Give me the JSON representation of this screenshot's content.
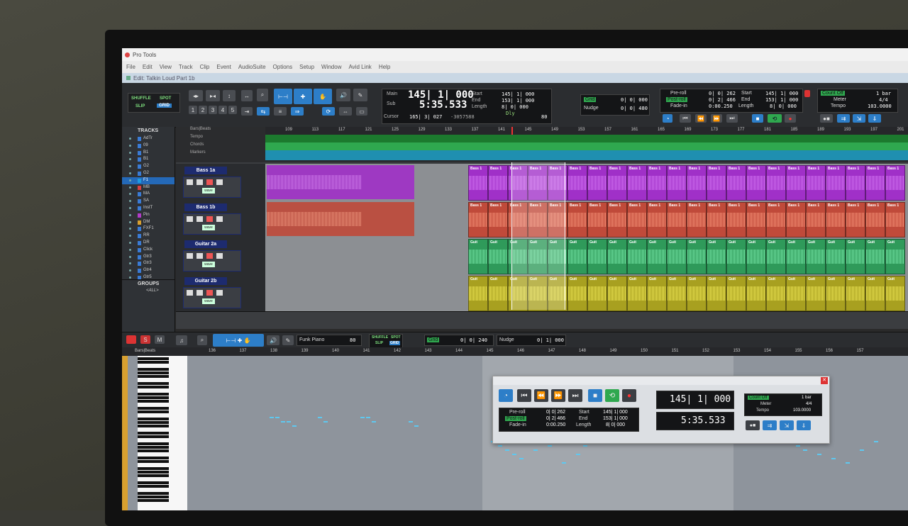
{
  "app": {
    "title": "Pro Tools",
    "edit_window_title": "Edit: Talkin Loud Part 1b"
  },
  "menu": [
    "File",
    "Edit",
    "View",
    "Track",
    "Clip",
    "Event",
    "AudioSuite",
    "Options",
    "Setup",
    "Window",
    "Avid Link",
    "Help"
  ],
  "modes": {
    "shuffle": "SHUFFLE",
    "spot": "SPOT",
    "slip": "SLIP",
    "grid": "GRID"
  },
  "grid_numbers": [
    "1",
    "2",
    "3",
    "4",
    "5"
  ],
  "counter": {
    "main_label": "Main",
    "main_value": "145| 1| 000",
    "sub_label": "Sub",
    "sub_value": "5:35.533",
    "start_label": "Start",
    "start_value": "145| 1| 000",
    "end_label": "End",
    "end_value": "153| 1| 000",
    "length_label": "Length",
    "length_value": "8| 0| 000",
    "cursor_label": "Cursor",
    "cursor_value": "165| 3| 027",
    "cursor_sample": "-3057588",
    "dly_label": "Dly",
    "bpm": "80"
  },
  "grid_nudge": {
    "grid_label": "Grid",
    "grid_value": "0| 0| 000",
    "nudge_label": "Nudge",
    "nudge_value": "0| 0| 480"
  },
  "transport": {
    "preroll_label": "Pre-roll",
    "preroll_value": "0| 0| 262",
    "postroll_label": "Post-roll",
    "postroll_value": "0| 2| 466",
    "fadein_label": "Fade-in",
    "fadein_value": "0:00.250",
    "start_label": "Start",
    "start_value": "145| 1| 000",
    "end_label": "End",
    "end_value": "153| 1| 000",
    "length_label": "Length",
    "length_value": "8| 0| 000",
    "countoff_label": "Count Off",
    "countoff_value": "1 bar",
    "meter_label": "Meter",
    "meter_value": "4/4",
    "tempo_label": "Tempo",
    "tempo_value": "103.0000"
  },
  "tracks_panel": {
    "header": "TRACKS",
    "items": [
      "AdTr",
      "09",
      "B1",
      "B1",
      "G2",
      "G2",
      "F1",
      "MB",
      "MA",
      "SA",
      "InstT",
      "Pin",
      "DM",
      "FXF1",
      "RR",
      "DR",
      "Click",
      "Gtr3",
      "Gtr3",
      "Gtr4",
      "Gtr5"
    ],
    "selected_index": 6,
    "colors": [
      "#3a7bd5",
      "#3a7bd5",
      "#3a7bd5",
      "#3a7bd5",
      "#3a7bd5",
      "#3a7bd5",
      "#1e9be0",
      "#d84040",
      "#3a7bd5",
      "#3a7bd5",
      "#3a7bd5",
      "#b23cc8",
      "#d8a030",
      "#3a7bd5",
      "#3a7bd5",
      "#3a7bd5",
      "#3a7bd5",
      "#3a7bd5",
      "#3a7bd5",
      "#3a7bd5",
      "#3a7bd5"
    ]
  },
  "groups_panel": {
    "header": "GROUPS",
    "all": "<ALL>"
  },
  "rulers": {
    "bars_beats": "Bars|Beats",
    "tempo": "Tempo",
    "chords": "Chords",
    "markers": "Markers"
  },
  "bar_ticks": [
    "109",
    "113",
    "117",
    "121",
    "125",
    "129",
    "133",
    "137",
    "141",
    "145",
    "149",
    "153",
    "157",
    "161",
    "165",
    "169",
    "173",
    "177",
    "181",
    "185",
    "189",
    "193",
    "197",
    "201"
  ],
  "tracks": [
    {
      "name": "Bass 1a",
      "clip_label": "Bass 1",
      "color": "#a030c8",
      "wave": "#d070f0"
    },
    {
      "name": "Bass 1b",
      "clip_label": "Bass 1",
      "color": "#c04a3a",
      "wave": "#f08a70"
    },
    {
      "name": "Guitar 2a",
      "clip_label": "Guit",
      "color": "#2f9a5a",
      "wave": "#70e0a0"
    },
    {
      "name": "Guitar 2b",
      "clip_label": "Guit",
      "color": "#a8a020",
      "wave": "#e8e050"
    }
  ],
  "track_buttons": {
    "wave": "wave"
  },
  "midi_bar": {
    "instrument": "Funk Piano",
    "bpm": "80",
    "grid_value": "0| 0| 240",
    "nudge_label": "Nudge",
    "nudge_value": "0| 1| 000"
  },
  "midi_ruler": {
    "label": "Bars|Beats",
    "ticks": [
      "136",
      "137",
      "138",
      "139",
      "140",
      "141",
      "142",
      "143",
      "144",
      "145",
      "146",
      "147",
      "148",
      "149",
      "150",
      "151",
      "152",
      "153",
      "154",
      "155",
      "156",
      "157"
    ]
  },
  "float_transport": {
    "main_value": "145| 1| 000",
    "sub_value": "5:35.533",
    "preroll_label": "Pre-roll",
    "preroll_value": "0| 0| 262",
    "postroll_label": "Post-roll",
    "postroll_value": "0| 2| 466",
    "fadein_label": "Fade-in",
    "fadein_value": "0:00.250",
    "start_label": "Start",
    "start_value": "145| 1| 000",
    "end_label": "End",
    "end_value": "153| 1| 000",
    "length_label": "Length",
    "length_value": "8| 0| 000",
    "countoff_label": "Count Off",
    "countoff_value": "1 bar",
    "meter_label": "Meter",
    "meter_value": "4/4",
    "tempo_label": "Tempo",
    "tempo_value": "103.0000"
  }
}
